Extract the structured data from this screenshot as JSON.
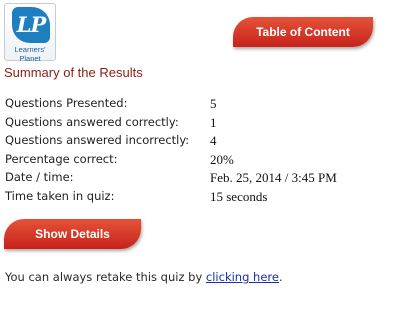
{
  "logo": {
    "mark": "LP",
    "text": "Learners' Planet"
  },
  "toc_button_label": "Table of Content",
  "summary_title": "Summary of the Results",
  "results": [
    {
      "label": "Questions Presented:",
      "value": "5"
    },
    {
      "label": "Questions answered correctly:",
      "value": "1"
    },
    {
      "label": "Questions answered incorrectly:",
      "value": "4"
    },
    {
      "label": "Percentage correct:",
      "value": "20%"
    },
    {
      "label": "Date / time:",
      "value": "Feb. 25, 2014 / 3:45 PM"
    },
    {
      "label": "Time taken in quiz:",
      "value": "15 seconds"
    }
  ],
  "details_button_label": "Show Details",
  "retake": {
    "text": "You can always retake this quiz by ",
    "link": "clicking here",
    "suffix": "."
  },
  "colors": {
    "button_red": "#d3321f",
    "title_red": "#8a1d12",
    "link_blue": "#1a2fa8",
    "logo_blue": "#1e7fc0"
  }
}
